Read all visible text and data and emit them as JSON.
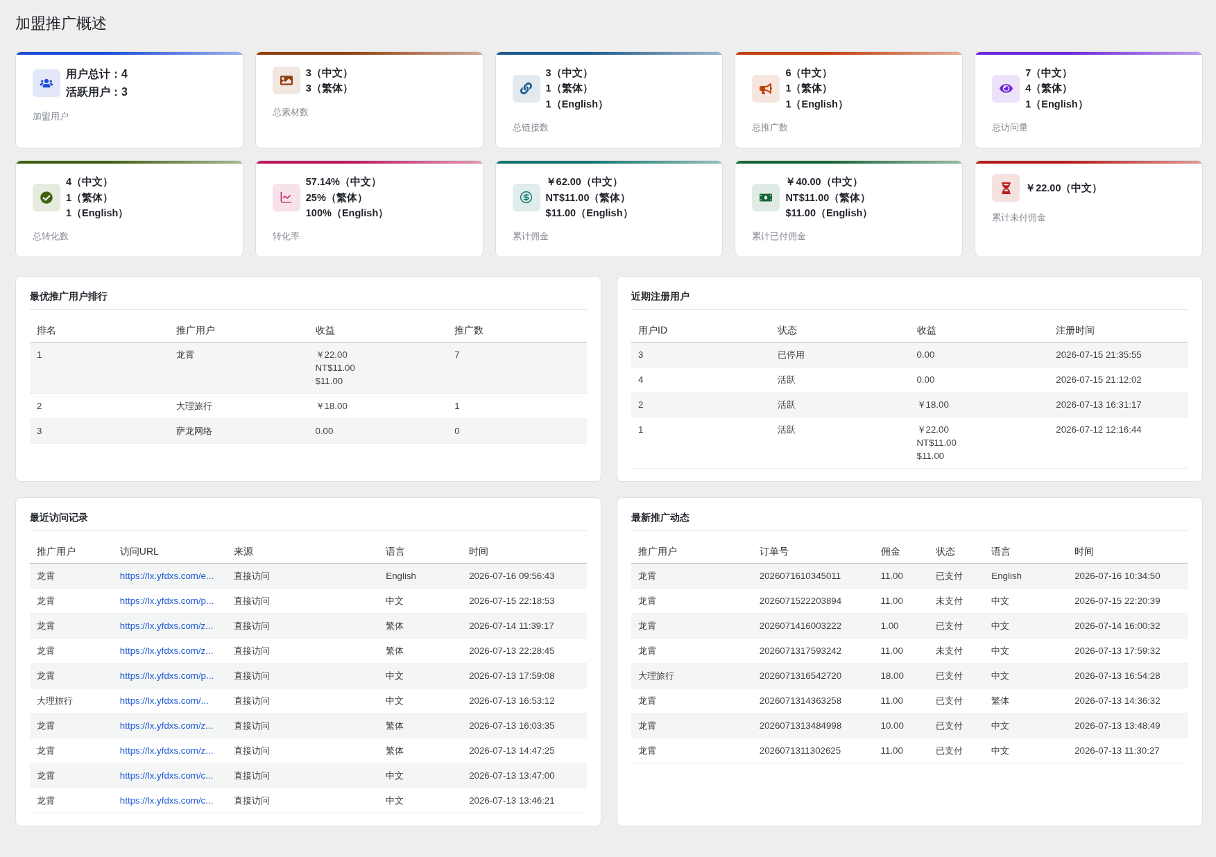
{
  "page_title": "加盟推广概述",
  "stat_cards": [
    {
      "kind": "summary",
      "color": "#1d4ed8",
      "lines": [
        "用户总计：4",
        "活跃用户：3"
      ],
      "label": "加盟用户"
    },
    {
      "kind": "breakdown",
      "color": "#92400e",
      "lines": [
        "3（中文）",
        "3（繁体）"
      ],
      "label": "总素材数"
    },
    {
      "kind": "breakdown",
      "color": "#1e5b8c",
      "lines": [
        "3（中文）",
        "1（繁体）",
        "1（English）"
      ],
      "label": "总链接数"
    },
    {
      "kind": "breakdown",
      "color": "#c2410c",
      "lines": [
        "6（中文）",
        "1（繁体）",
        "1（English）"
      ],
      "label": "总推广数"
    },
    {
      "kind": "breakdown",
      "color": "#6d28d9",
      "lines": [
        "7（中文）",
        "4（繁体）",
        "1（English）"
      ],
      "label": "总访问量"
    },
    {
      "kind": "breakdown",
      "color": "#3f6212",
      "lines": [
        "4（中文）",
        "1（繁体）",
        "1（English）"
      ],
      "label": "总转化数"
    },
    {
      "kind": "breakdown",
      "color": "#be185d",
      "lines": [
        "57.14%（中文）",
        "25%（繁体）",
        "100%（English）"
      ],
      "label": "转化率"
    },
    {
      "kind": "breakdown",
      "color": "#0f766e",
      "lines": [
        "￥62.00（中文）",
        "NT$11.00（繁体）",
        "$11.00（English）"
      ],
      "label": "累计佣金"
    },
    {
      "kind": "breakdown",
      "color": "#166534",
      "lines": [
        "￥40.00（中文）",
        "NT$11.00（繁体）",
        "$11.00（English）"
      ],
      "label": "累计已付佣金"
    },
    {
      "kind": "breakdown",
      "color": "#b91c1c",
      "lines": [
        "￥22.00（中文）"
      ],
      "label": "累计未付佣金"
    }
  ],
  "top_promoters": {
    "title": "最优推广用户排行",
    "columns": [
      "排名",
      "推广用户",
      "收益",
      "推广数"
    ],
    "rows": [
      {
        "rank": "1",
        "user": "龙霄",
        "earnings": [
          "￥22.00",
          "NT$11.00",
          "$11.00"
        ],
        "promotions": "7"
      },
      {
        "rank": "2",
        "user": "大理旅行",
        "earnings": [
          "￥18.00"
        ],
        "promotions": "1"
      },
      {
        "rank": "3",
        "user": "萨龙网络",
        "earnings": [
          "0.00"
        ],
        "promotions": "0"
      }
    ]
  },
  "recent_registrations": {
    "title": "近期注册用户",
    "columns": [
      "用户ID",
      "状态",
      "收益",
      "注册时间"
    ],
    "rows": [
      {
        "user_id": "3",
        "status": "已停用",
        "earnings": [
          "0.00"
        ],
        "registered_at": "2026-07-15 21:35:55"
      },
      {
        "user_id": "4",
        "status": "活跃",
        "earnings": [
          "0.00"
        ],
        "registered_at": "2026-07-15 21:12:02"
      },
      {
        "user_id": "2",
        "status": "活跃",
        "earnings": [
          "￥18.00"
        ],
        "registered_at": "2026-07-13 16:31:17"
      },
      {
        "user_id": "1",
        "status": "活跃",
        "earnings": [
          "￥22.00",
          "NT$11.00",
          "$11.00"
        ],
        "registered_at": "2026-07-12 12:16:44"
      }
    ]
  },
  "recent_visits": {
    "title": "最近访问记录",
    "columns": [
      "推广用户",
      "访问URL",
      "来源",
      "语言",
      "时间"
    ],
    "rows": [
      {
        "user": "龙霄",
        "url": "https://lx.yfdxs.com/e...",
        "source": "直接访问",
        "language": "English",
        "time": "2026-07-16 09:56:43"
      },
      {
        "user": "龙霄",
        "url": "https://lx.yfdxs.com/p...",
        "source": "直接访问",
        "language": "中文",
        "time": "2026-07-15 22:18:53"
      },
      {
        "user": "龙霄",
        "url": "https://lx.yfdxs.com/z...",
        "source": "直接访问",
        "language": "繁体",
        "time": "2026-07-14 11:39:17"
      },
      {
        "user": "龙霄",
        "url": "https://lx.yfdxs.com/z...",
        "source": "直接访问",
        "language": "繁体",
        "time": "2026-07-13 22:28:45"
      },
      {
        "user": "龙霄",
        "url": "https://lx.yfdxs.com/p...",
        "source": "直接访问",
        "language": "中文",
        "time": "2026-07-13 17:59:08"
      },
      {
        "user": "大理旅行",
        "url": "https://lx.yfdxs.com/...",
        "source": "直接访问",
        "language": "中文",
        "time": "2026-07-13 16:53:12"
      },
      {
        "user": "龙霄",
        "url": "https://lx.yfdxs.com/z...",
        "source": "直接访问",
        "language": "繁体",
        "time": "2026-07-13 16:03:35"
      },
      {
        "user": "龙霄",
        "url": "https://lx.yfdxs.com/z...",
        "source": "直接访问",
        "language": "繁体",
        "time": "2026-07-13 14:47:25"
      },
      {
        "user": "龙霄",
        "url": "https://lx.yfdxs.com/c...",
        "source": "直接访问",
        "language": "中文",
        "time": "2026-07-13 13:47:00"
      },
      {
        "user": "龙霄",
        "url": "https://lx.yfdxs.com/c...",
        "source": "直接访问",
        "language": "中文",
        "time": "2026-07-13 13:46:21"
      }
    ]
  },
  "latest_promotions": {
    "title": "最新推广动态",
    "columns": [
      "推广用户",
      "订单号",
      "佣金",
      "状态",
      "语言",
      "时间"
    ],
    "rows": [
      {
        "user": "龙霄",
        "order_no": "2026071610345011",
        "commission": "11.00",
        "status": "已支付",
        "language": "English",
        "time": "2026-07-16 10:34:50"
      },
      {
        "user": "龙霄",
        "order_no": "2026071522203894",
        "commission": "11.00",
        "status": "未支付",
        "language": "中文",
        "time": "2026-07-15 22:20:39"
      },
      {
        "user": "龙霄",
        "order_no": "2026071416003222",
        "commission": "1.00",
        "status": "已支付",
        "language": "中文",
        "time": "2026-07-14 16:00:32"
      },
      {
        "user": "龙霄",
        "order_no": "2026071317593242",
        "commission": "11.00",
        "status": "未支付",
        "language": "中文",
        "time": "2026-07-13 17:59:32"
      },
      {
        "user": "大理旅行",
        "order_no": "2026071316542720",
        "commission": "18.00",
        "status": "已支付",
        "language": "中文",
        "time": "2026-07-13 16:54:28"
      },
      {
        "user": "龙霄",
        "order_no": "2026071314363258",
        "commission": "11.00",
        "status": "已支付",
        "language": "繁体",
        "time": "2026-07-13 14:36:32"
      },
      {
        "user": "龙霄",
        "order_no": "2026071313484998",
        "commission": "10.00",
        "status": "已支付",
        "language": "中文",
        "time": "2026-07-13 13:48:49"
      },
      {
        "user": "龙霄",
        "order_no": "2026071311302625",
        "commission": "11.00",
        "status": "已支付",
        "language": "中文",
        "time": "2026-07-13 11:30:27"
      }
    ]
  }
}
